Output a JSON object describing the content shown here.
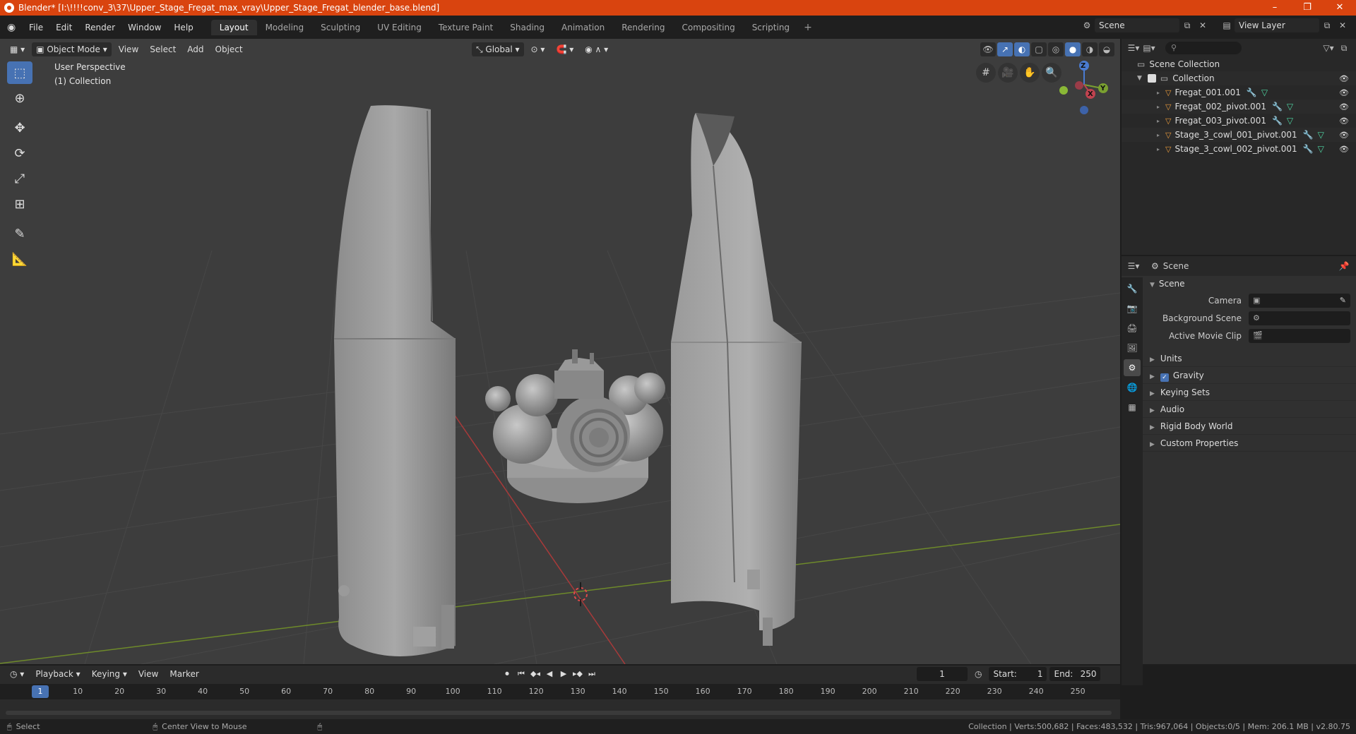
{
  "window": {
    "title": "Blender* [I:\\!!!!conv_3\\37\\Upper_Stage_Fregat_max_vray\\Upper_Stage_Fregat_blender_base.blend]",
    "minimize": "–",
    "maximize": "❐",
    "close": "✕"
  },
  "menu": [
    "File",
    "Edit",
    "Render",
    "Window",
    "Help"
  ],
  "workspaces": [
    "Layout",
    "Modeling",
    "Sculpting",
    "UV Editing",
    "Texture Paint",
    "Shading",
    "Animation",
    "Rendering",
    "Compositing",
    "Scripting"
  ],
  "active_workspace": "Layout",
  "scene_name": "Scene",
  "view_layer": "View Layer",
  "viewport": {
    "mode": "Object Mode",
    "menus": [
      "View",
      "Select",
      "Add",
      "Object"
    ],
    "transform_orientation": "Global",
    "perspective_label": "User Perspective",
    "collection_label": "(1) Collection",
    "gizmo": {
      "x": "X",
      "y": "Y",
      "z": "Z"
    }
  },
  "outliner": {
    "root": "Scene Collection",
    "collection": "Collection",
    "objects": [
      "Fregat_001.001",
      "Fregat_002_pivot.001",
      "Fregat_003_pivot.001",
      "Stage_3_cowl_001_pivot.001",
      "Stage_3_cowl_002_pivot.001"
    ]
  },
  "properties": {
    "context": "Scene",
    "panel_title": "Scene",
    "fields": [
      {
        "label": "Camera",
        "value": ""
      },
      {
        "label": "Background Scene",
        "value": ""
      },
      {
        "label": "Active Movie Clip",
        "value": ""
      }
    ],
    "panels": [
      "Units",
      "Gravity",
      "Keying Sets",
      "Audio",
      "Rigid Body World",
      "Custom Properties"
    ],
    "gravity_enabled": true
  },
  "timeline": {
    "menus": [
      "Playback",
      "Keying",
      "View",
      "Marker"
    ],
    "current_frame": "1",
    "start_label": "Start:",
    "start": "1",
    "end_label": "End:",
    "end": "250",
    "ruler": [
      "1",
      "10",
      "20",
      "30",
      "40",
      "50",
      "60",
      "70",
      "80",
      "90",
      "100",
      "110",
      "120",
      "130",
      "140",
      "150",
      "160",
      "170",
      "180",
      "190",
      "200",
      "210",
      "220",
      "230",
      "240",
      "250"
    ]
  },
  "status": {
    "left": "Select",
    "middle": "Center View to Mouse",
    "right": "Collection | Verts:500,682 | Faces:483,532 | Tris:967,064 | Objects:0/5 | Mem: 206.1 MB | v2.80.75"
  },
  "colors": {
    "titlebar": "#d9440f",
    "accent": "#4772b3",
    "viewport_bg": "#3d3d3d",
    "x_axis": "#c03c3c",
    "y_axis": "#7a9a2c",
    "object_icon": "#e89a3c"
  }
}
